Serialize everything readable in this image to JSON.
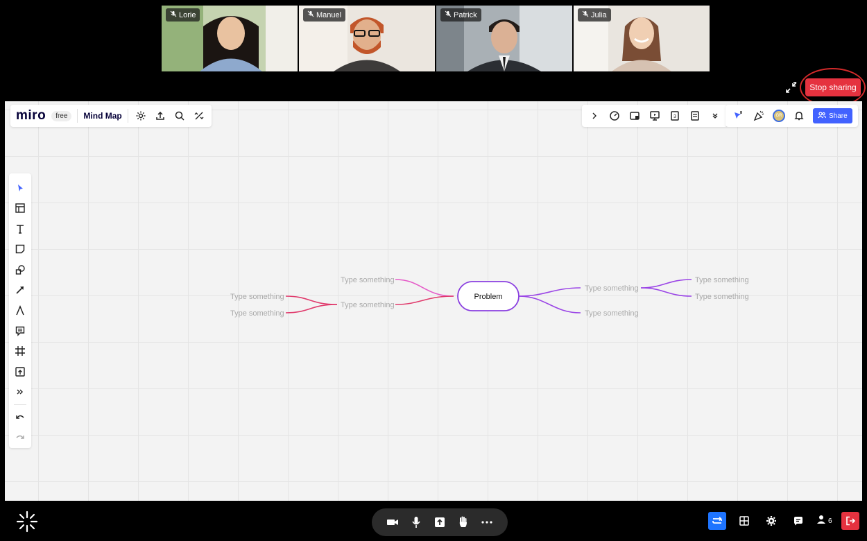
{
  "participants": [
    {
      "name": "Lorie",
      "muted": true,
      "bg": "#b8c7a4",
      "skin": "#e9c2a0",
      "hair": "#1b1512",
      "shirt": "#8ea9cd"
    },
    {
      "name": "Manuel",
      "muted": true,
      "bg": "#e2ddd6",
      "skin": "#e2b08c",
      "hair": "#c2562a",
      "shirt": "#3d3b3a"
    },
    {
      "name": "Patrick",
      "muted": true,
      "bg": "#9aa2a8",
      "skin": "#dbb195",
      "hair": "#231d1a",
      "shirt": "#2b2e33"
    },
    {
      "name": "Julia",
      "muted": true,
      "bg": "#e6e2dc",
      "skin": "#f0cfb3",
      "hair": "#7a4d35",
      "shirt": "#d6c2b2"
    }
  ],
  "share": {
    "stop_label": "Stop sharing"
  },
  "board": {
    "logo": "miro",
    "plan": "free",
    "name": "Mind Map",
    "share_label": "Share",
    "avatar_initials": "GR"
  },
  "mindmap": {
    "center": "Problem",
    "placeholder": "Type something",
    "colors": {
      "pink": "#e55bc8",
      "red": "#e03a6c",
      "purple": "#9a44e6",
      "center_border": "#8a3fe0"
    }
  },
  "bottom": {
    "participant_count": "6",
    "accent": "#1e74ff",
    "leave_color": "#e5323f"
  }
}
